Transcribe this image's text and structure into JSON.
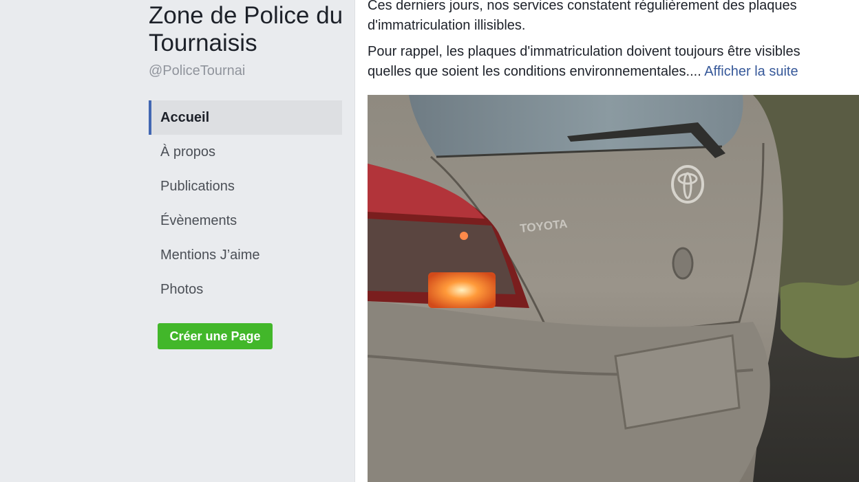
{
  "page": {
    "name": "Zone de Police du Tournaisis",
    "handle": "@PoliceTournai"
  },
  "nav": {
    "items": [
      {
        "label": "Accueil",
        "active": true
      },
      {
        "label": "À propos"
      },
      {
        "label": "Publications"
      },
      {
        "label": "Évènements"
      },
      {
        "label": "Mentions J’aime"
      },
      {
        "label": "Photos"
      }
    ]
  },
  "create_page_label": "Créer une Page",
  "post": {
    "paragraph1": "Ces derniers jours, nos services constatent régulièrement des plaques d'immatriculation illisibles.",
    "paragraph1_line1": "Ces derniers jours, nos services constatent régulièrement des plaques",
    "paragraph1_line2": "d'immatriculation illisibles.",
    "paragraph2_line1": "Pour rappel, les plaques d'immatriculation doivent toujours être visibles",
    "paragraph2_line2": "quelles que soient les conditions environnementales....",
    "see_more": "Afficher la suite",
    "photo_badge_text": "TOYOTA"
  },
  "colors": {
    "accent": "#4267b2",
    "link": "#365899",
    "create_button": "#42b72a",
    "background": "#e9ebee"
  },
  "icons": {
    "car_logo": "toyota-logo-icon"
  }
}
